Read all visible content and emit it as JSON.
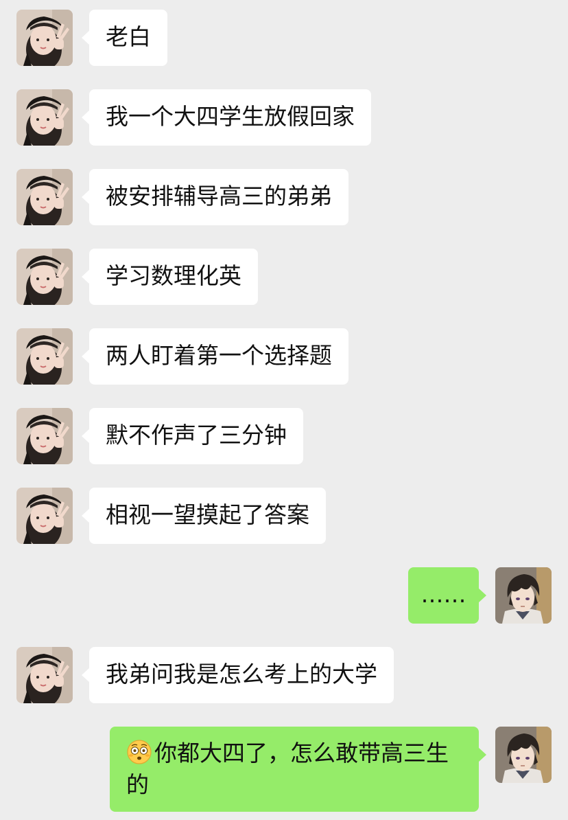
{
  "colors": {
    "background": "#ededed",
    "incoming_bubble": "#ffffff",
    "outgoing_bubble": "#95ec69"
  },
  "messages": [
    {
      "sender": "contact",
      "avatar_icon": "girl-beret-avatar-icon",
      "text": "老白"
    },
    {
      "sender": "contact",
      "avatar_icon": "girl-beret-avatar-icon",
      "text": "我一个大四学生放假回家"
    },
    {
      "sender": "contact",
      "avatar_icon": "girl-beret-avatar-icon",
      "text": "被安排辅导高三的弟弟"
    },
    {
      "sender": "contact",
      "avatar_icon": "girl-beret-avatar-icon",
      "text": "学习数理化英"
    },
    {
      "sender": "contact",
      "avatar_icon": "girl-beret-avatar-icon",
      "text": "两人盯着第一个选择题"
    },
    {
      "sender": "contact",
      "avatar_icon": "girl-beret-avatar-icon",
      "text": "默不作声了三分钟"
    },
    {
      "sender": "contact",
      "avatar_icon": "girl-beret-avatar-icon",
      "text": "相视一望摸起了答案"
    },
    {
      "sender": "me",
      "avatar_icon": "anime-boy-avatar-icon",
      "text": "……"
    },
    {
      "sender": "contact",
      "avatar_icon": "girl-beret-avatar-icon",
      "text": "我弟问我是怎么考上的大学"
    },
    {
      "sender": "me",
      "avatar_icon": "anime-boy-avatar-icon",
      "emoji_icon": "flushed-face-emoji-icon",
      "text": "你都大四了，怎么敢带高三生的"
    }
  ]
}
